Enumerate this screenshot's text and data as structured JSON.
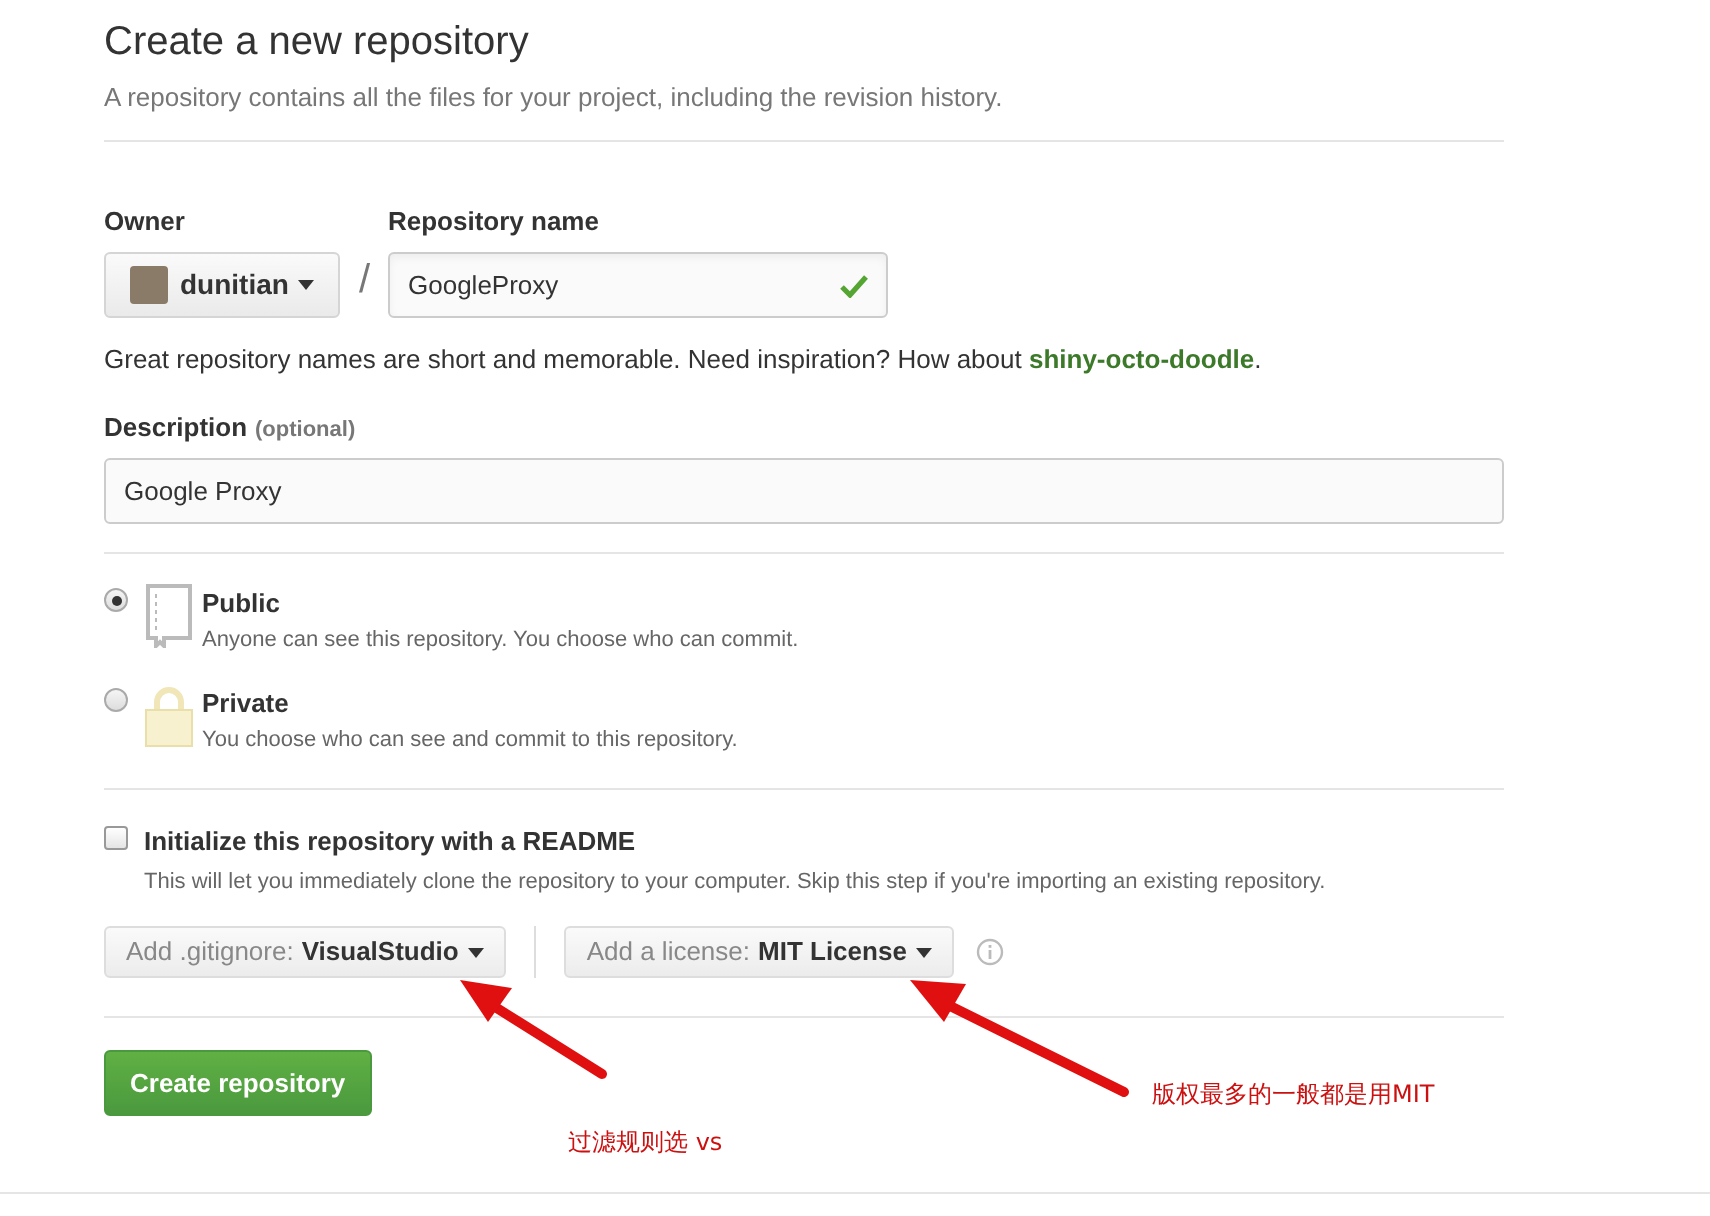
{
  "header": {
    "title": "Create a new repository",
    "subtitle": "A repository contains all the files for your project, including the revision history."
  },
  "owner": {
    "label": "Owner",
    "value": "dunitian"
  },
  "separator": "/",
  "repository_name": {
    "label": "Repository name",
    "value": "GoogleProxy",
    "valid": true
  },
  "name_hint": {
    "text": "Great repository names are short and memorable. Need inspiration? How about ",
    "suggestion": "shiny-octo-doodle",
    "end": "."
  },
  "description": {
    "label": "Description",
    "optional": "(optional)",
    "value": "Google Proxy"
  },
  "visibility": [
    {
      "kind": "public",
      "title": "Public",
      "text": "Anyone can see this repository. You choose who can commit.",
      "selected": true
    },
    {
      "kind": "private",
      "title": "Private",
      "text": "You choose who can see and commit to this repository.",
      "selected": false
    }
  ],
  "readme": {
    "label": "Initialize this repository with a README",
    "text": "This will let you immediately clone the repository to your computer. Skip this step if you're importing an existing repository.",
    "checked": false
  },
  "gitignore": {
    "label": "Add .gitignore:",
    "value": "VisualStudio"
  },
  "license": {
    "label": "Add a license:",
    "value": "MIT License"
  },
  "submit": "Create repository",
  "annotations": [
    {
      "text": "过滤规则选 vs"
    },
    {
      "text": "版权最多的一般都是用MIT"
    }
  ]
}
